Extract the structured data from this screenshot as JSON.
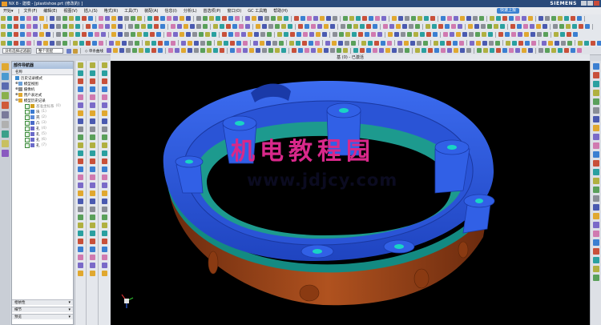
{
  "window": {
    "title": "NX 8 - 建模 - [plastishoe.prt  (修改的) ]",
    "brand": "SIEMENS",
    "help_label": "快速上报"
  },
  "menus": [
    "开始▾",
    "文件(F)",
    "编辑(E)",
    "视图(V)",
    "插入(S)",
    "格式(R)",
    "工具(T)",
    "装配(A)",
    "信息(I)",
    "分析(L)",
    "首选项(P)",
    "窗口(O)",
    "GC 工具箱",
    "帮助(H)"
  ],
  "toolbar": {
    "filter_dropdown": "没有选择过滤器",
    "scope_dropdown": "整个装配",
    "selection_label": "◇ 单条曲线"
  },
  "viewport": {
    "title": "基 (0) - 已激活",
    "watermark_cn": "机电教程园",
    "watermark_url": "www.jdjcy.com"
  },
  "navigator": {
    "title": "部件导航器",
    "column": "名称",
    "rows": [
      {
        "label": "历史记录模式",
        "dim": ""
      },
      {
        "label": "模型视图",
        "dim": ""
      },
      {
        "label": "摄像机",
        "dim": ""
      },
      {
        "label": "用户表达式",
        "dim": ""
      },
      {
        "label": "模型历史记录",
        "dim": ""
      },
      {
        "label": "基准坐标系",
        "dim": "(0)"
      },
      {
        "label": "块",
        "dim": "(1)"
      },
      {
        "label": "壳",
        "dim": "(2)"
      },
      {
        "label": "凸",
        "dim": "(3)"
      },
      {
        "label": "孔",
        "dim": "(4)"
      },
      {
        "label": "孔",
        "dim": "(5)"
      },
      {
        "label": "孔",
        "dim": "(6)"
      },
      {
        "label": "孔",
        "dim": "(7)"
      }
    ],
    "panels": [
      "相依性",
      "细节",
      "预览"
    ]
  },
  "colors": {
    "blue_body": "#2f5fe0",
    "teal_band": "#138a82",
    "brown_shell": "#a0481c",
    "cyan_hole": "#19d4c4"
  }
}
